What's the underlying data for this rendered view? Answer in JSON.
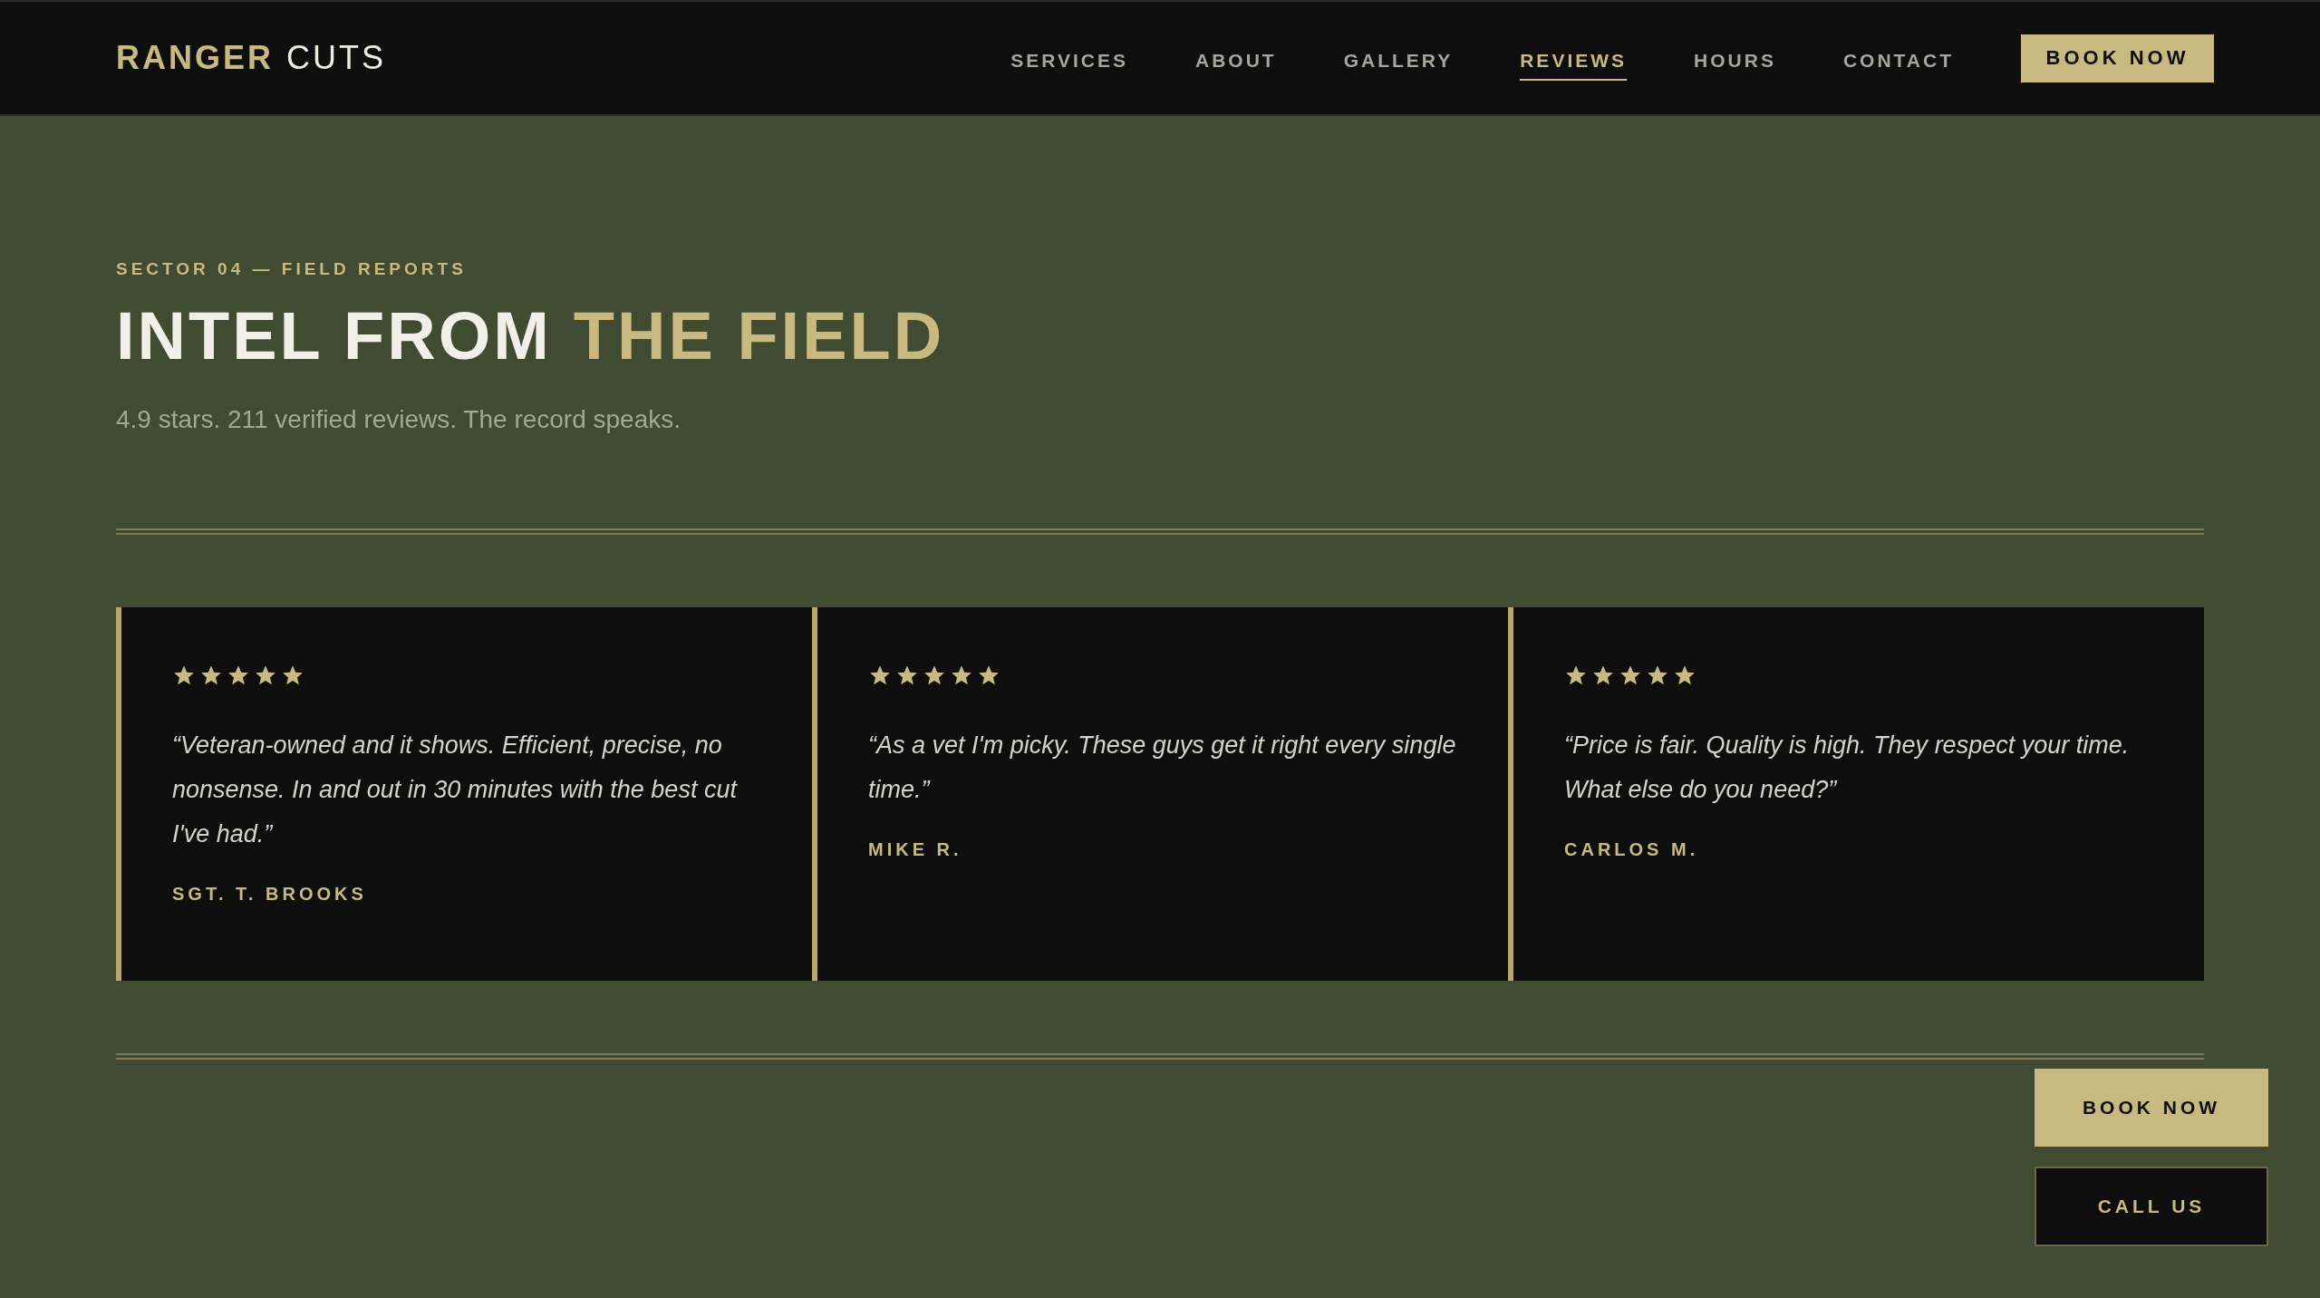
{
  "header": {
    "brand": {
      "primary": "RANGER",
      "secondary": "CUTS"
    },
    "nav": [
      {
        "label": "SERVICES",
        "selected": false
      },
      {
        "label": "ABOUT",
        "selected": false
      },
      {
        "label": "GALLERY",
        "selected": false
      },
      {
        "label": "REVIEWS",
        "selected": true
      },
      {
        "label": "HOURS",
        "selected": false
      },
      {
        "label": "CONTACT",
        "selected": false
      }
    ],
    "cta": "BOOK NOW"
  },
  "section": {
    "eyebrow": "SECTOR 04 — FIELD REPORTS",
    "title": {
      "main": "INTEL FROM",
      "accent": "THE FIELD"
    },
    "subtitle": "4.9 stars. 211 verified reviews. The record speaks."
  },
  "reviews": [
    {
      "stars": 5,
      "quote": "“Veteran-owned and it shows. Efficient, precise, no nonsense. In and out in 30 minutes with the best cut I've had.”",
      "author": "SGT. T. BROOKS"
    },
    {
      "stars": 5,
      "quote": "“As a vet I'm picky. These guys get it right every single time.”",
      "author": "MIKE R."
    },
    {
      "stars": 5,
      "quote": "“Price is fair. Quality is high. They respect your time. What else do you need?”",
      "author": "CARLOS M."
    }
  ],
  "floating_actions": {
    "book": "BOOK NOW",
    "call": "CALL US"
  }
}
